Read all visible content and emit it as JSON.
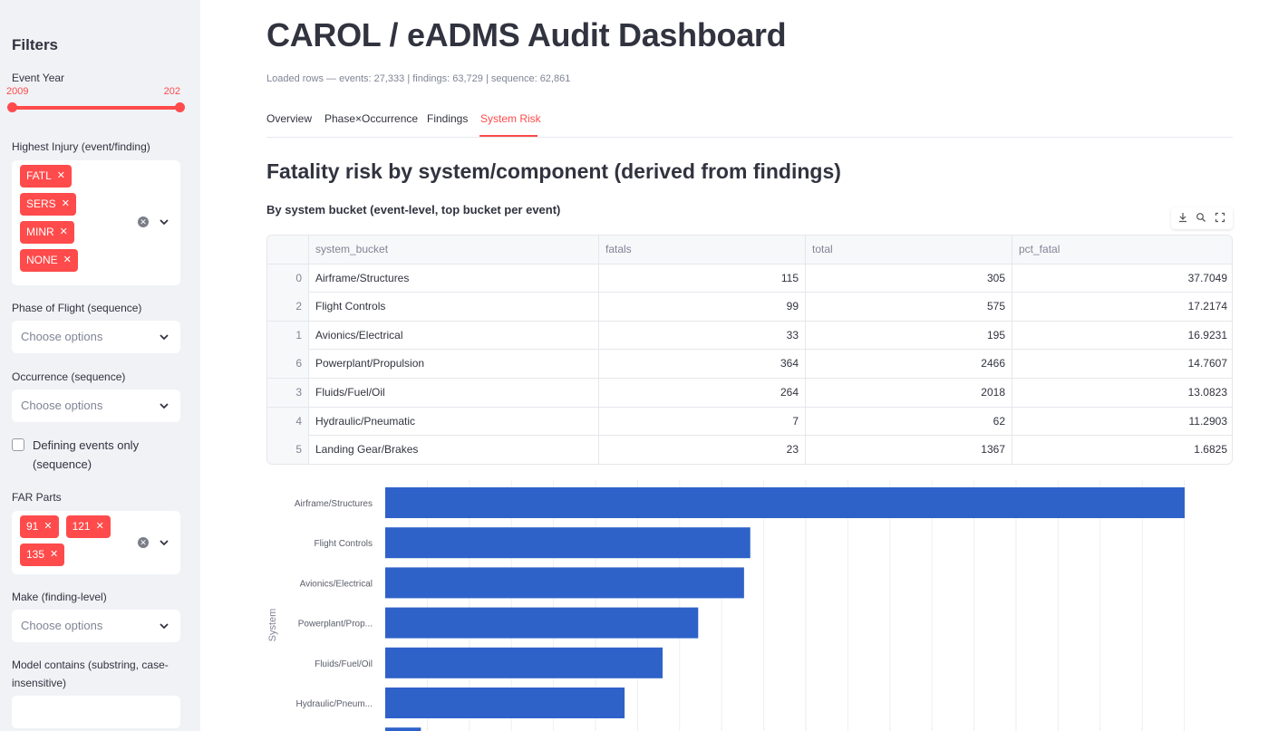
{
  "sidebar": {
    "title": "Filters",
    "event_year": {
      "label": "Event Year",
      "min_label": "2009",
      "max_label": "202"
    },
    "highest_injury": {
      "label": "Highest Injury (event/finding)",
      "tags": [
        "FATL",
        "SERS",
        "MINR",
        "NONE"
      ]
    },
    "phase": {
      "label": "Phase of Flight (sequence)",
      "placeholder": "Choose options"
    },
    "occurrence": {
      "label": "Occurrence (sequence)",
      "placeholder": "Choose options"
    },
    "defining_events": {
      "label": "Defining events only (sequence)",
      "checked": false
    },
    "far_parts": {
      "label": "FAR Parts",
      "tags": [
        "91",
        "121",
        "135"
      ]
    },
    "make": {
      "label": "Make (finding-level)",
      "placeholder": "Choose options"
    },
    "model": {
      "label": "Model contains (substring, case-insensitive)",
      "value": ""
    }
  },
  "main": {
    "title": "CAROL / eADMS Audit Dashboard",
    "caption": "Loaded rows — events: 27,333 | findings: 63,729 | sequence: 62,861",
    "tabs": [
      "Overview",
      "Phase×Occurrence",
      "Findings",
      "System Risk"
    ],
    "active_tab": "System Risk",
    "section_title": "Fatality risk by system/component (derived from findings)",
    "subsection_title": "By system bucket (event-level, top bucket per event)",
    "toolbar_icons": [
      "download-icon",
      "search-icon",
      "fullscreen-icon"
    ]
  },
  "table": {
    "columns": [
      "",
      "system_bucket",
      "fatals",
      "total",
      "pct_fatal"
    ],
    "rows": [
      [
        "0",
        "Airframe/Structures",
        "115",
        "305",
        "37.7049"
      ],
      [
        "2",
        "Flight Controls",
        "99",
        "575",
        "17.2174"
      ],
      [
        "1",
        "Avionics/Electrical",
        "33",
        "195",
        "16.9231"
      ],
      [
        "6",
        "Powerplant/Propulsion",
        "364",
        "2466",
        "14.7607"
      ],
      [
        "3",
        "Fluids/Fuel/Oil",
        "264",
        "2018",
        "13.0823"
      ],
      [
        "4",
        "Hydraulic/Pneumatic",
        "7",
        "62",
        "11.2903"
      ],
      [
        "5",
        "Landing Gear/Brakes",
        "23",
        "1367",
        "1.6825"
      ]
    ]
  },
  "chart_data": {
    "type": "bar",
    "orientation": "horizontal",
    "categories": [
      "Airframe/Structures",
      "Flight Controls",
      "Avionics/Electrical",
      "Powerplant/Prop...",
      "Fluids/Fuel/Oil",
      "Hydraulic/Pneum...",
      "Landing Gear/Brakes"
    ],
    "values": [
      37.7049,
      17.2174,
      16.9231,
      14.7607,
      13.0823,
      11.2903,
      1.6825
    ],
    "ylabel": "System",
    "xlim": [
      0,
      40
    ],
    "bar_color": "#2e62c9",
    "grid": true
  },
  "colors": {
    "accent": "#ff4b4b",
    "bar": "#2e62c9"
  }
}
